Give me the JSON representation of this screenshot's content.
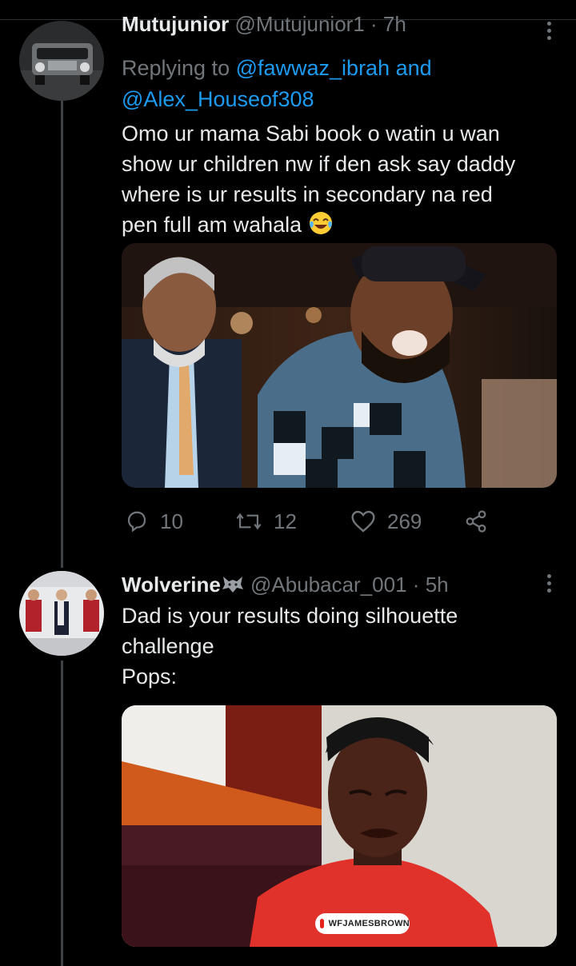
{
  "tweet1": {
    "display_name": "Mutujunior",
    "handle": "@Mutujunior1",
    "time": "7h",
    "replying_prefix": "Replying to ",
    "mention_1": "@fawwaz_ibrah",
    "and_word": " and",
    "mention_2": "@Alex_Houseof308",
    "text_lines": [
      "Omo ur mama Sabi book  o watin u wan",
      "show ur children nw if den ask say daddy",
      "where is ur results in secondary na red",
      "pen full am wahala"
    ],
    "emoji": "face-with-tears-of-joy",
    "stats": {
      "replies": "10",
      "retweets": "12",
      "likes": "269"
    }
  },
  "tweet2": {
    "display_name": "Wolverine",
    "name_emoji": "wolf-icon",
    "handle": "@Abubacar_001",
    "time": "5h",
    "text_lines": [
      "Dad is your results doing silhouette",
      "challenge",
      "Pops:"
    ],
    "video_watermark": "WFJAMESBROWN"
  },
  "colors": {
    "background": "#000000",
    "accent": "#1d9bf0",
    "muted": "#71767b",
    "text": "#e7e9ea",
    "thread_line": "#3e4144"
  }
}
